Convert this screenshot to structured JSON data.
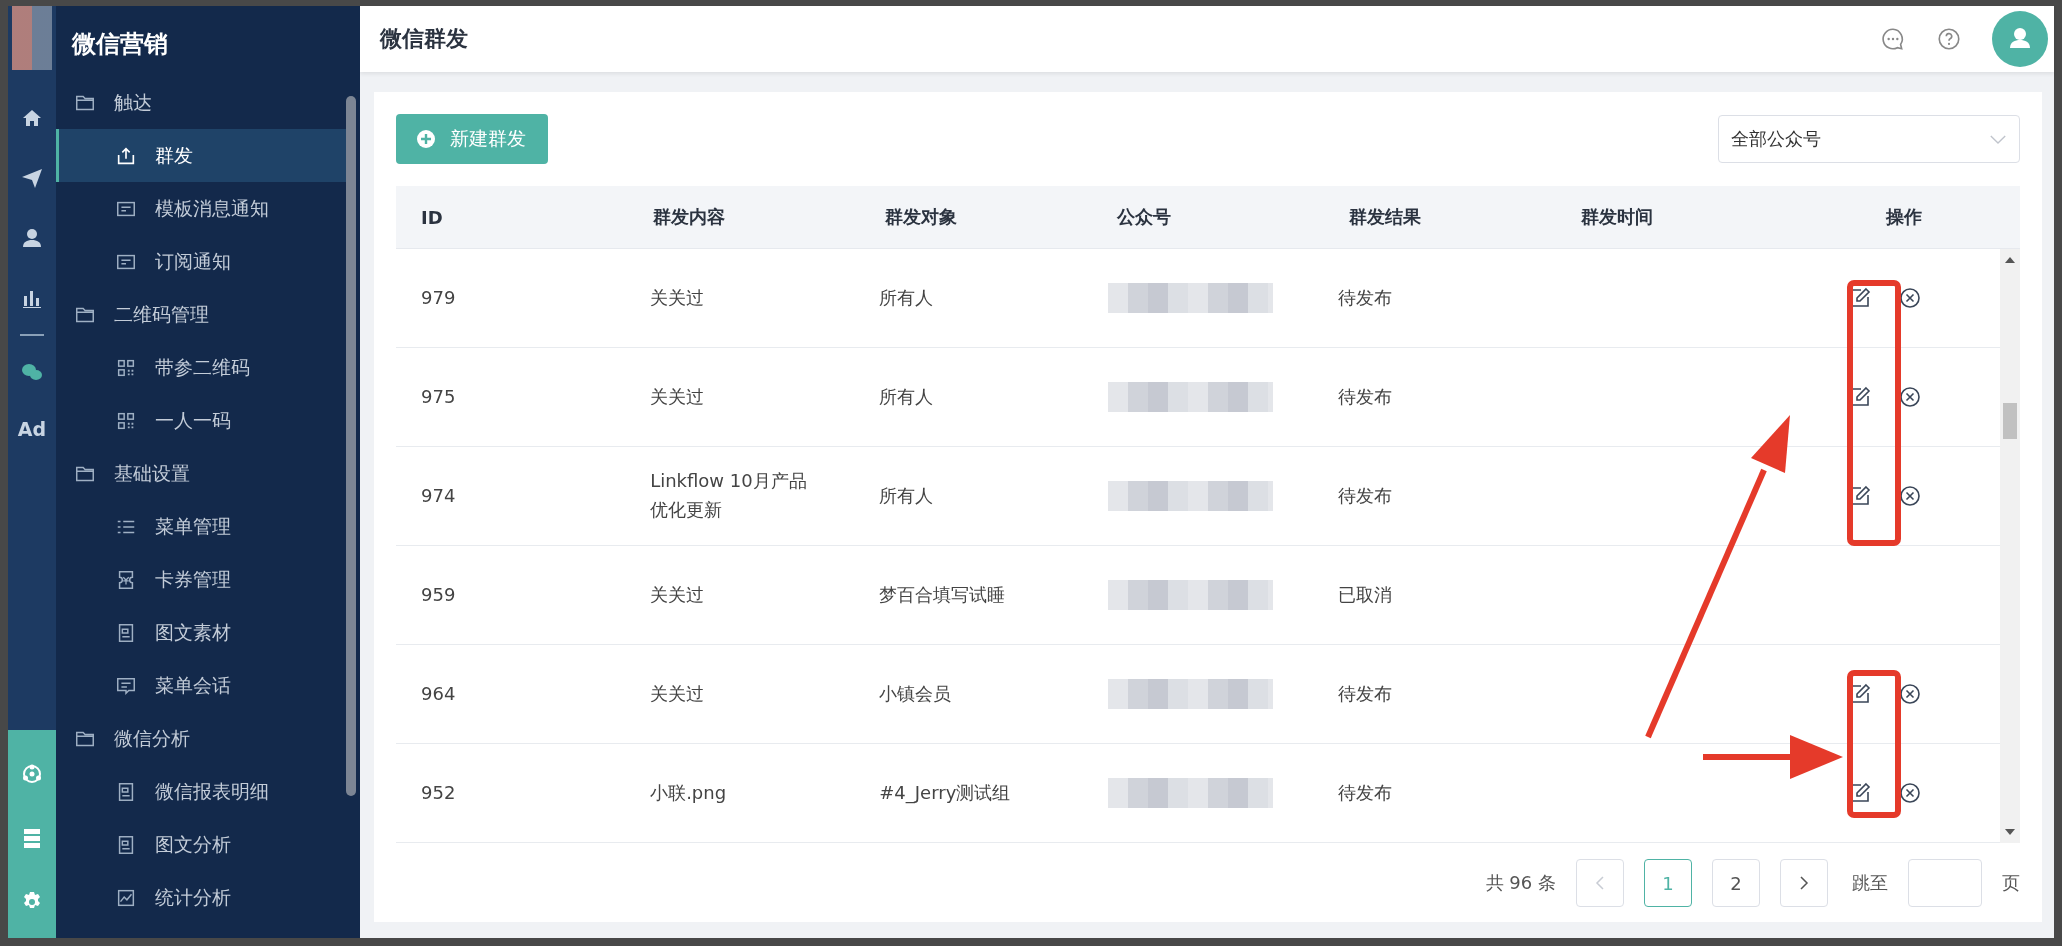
{
  "rail": {
    "badge": "Ad"
  },
  "sidebar": {
    "title": "微信营销",
    "groups": [
      {
        "label": "触达",
        "children": [
          {
            "label": "群发",
            "selected": true
          },
          {
            "label": "模板消息通知",
            "selected": false
          },
          {
            "label": "订阅通知",
            "selected": false
          }
        ]
      },
      {
        "label": "二维码管理",
        "children": [
          {
            "label": "带参二维码",
            "selected": false
          },
          {
            "label": "一人一码",
            "selected": false
          }
        ]
      },
      {
        "label": "基础设置",
        "children": [
          {
            "label": "菜单管理",
            "selected": false
          },
          {
            "label": "卡券管理",
            "selected": false
          },
          {
            "label": "图文素材",
            "selected": false
          },
          {
            "label": "菜单会话",
            "selected": false
          }
        ]
      },
      {
        "label": "微信分析",
        "children": [
          {
            "label": "微信报表明细",
            "selected": false
          },
          {
            "label": "图文分析",
            "selected": false
          },
          {
            "label": "统计分析",
            "selected": false
          }
        ]
      }
    ]
  },
  "header": {
    "title": "微信群发"
  },
  "toolbar": {
    "new_button": "新建群发",
    "account_select": "全部公众号"
  },
  "table": {
    "columns": [
      "ID",
      "群发内容",
      "群发对象",
      "公众号",
      "群发结果",
      "群发时间",
      "操作"
    ],
    "rows": [
      {
        "id": "979",
        "content": "关关过",
        "target": "所有人",
        "result": "待发布",
        "actions": true
      },
      {
        "id": "975",
        "content": "关关过",
        "target": "所有人",
        "result": "待发布",
        "actions": true
      },
      {
        "id": "974",
        "content": "Linkflow 10月产品优化更新",
        "target": "所有人",
        "result": "待发布",
        "actions": true
      },
      {
        "id": "959",
        "content": "关关过",
        "target": "梦百合填写试睡",
        "result": "已取消",
        "actions": false
      },
      {
        "id": "964",
        "content": "关关过",
        "target": "小镇会员",
        "result": "待发布",
        "actions": true
      },
      {
        "id": "952",
        "content": "小联.png",
        "target": "#4_Jerry测试组",
        "result": "待发布",
        "actions": true
      }
    ]
  },
  "pagination": {
    "total": "共 96 条",
    "prev": {
      "disabled": true
    },
    "pages": [
      {
        "label": "1",
        "selected": true
      },
      {
        "label": "2",
        "selected": false
      }
    ],
    "next": {
      "disabled": false
    },
    "jump_label": "跳至",
    "page_unit": "页"
  }
}
